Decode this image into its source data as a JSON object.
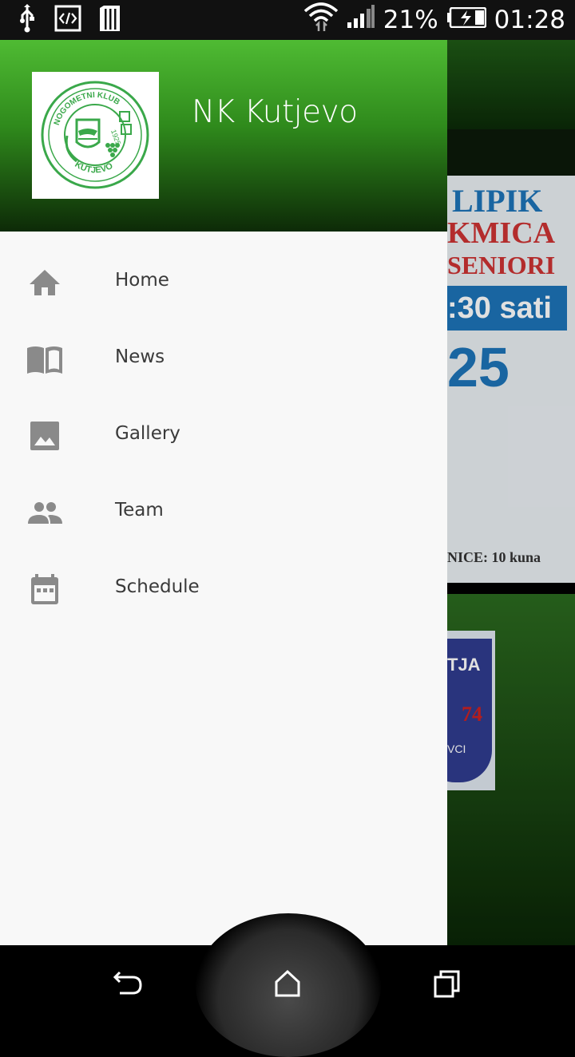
{
  "status_bar": {
    "battery_percent": "21%",
    "time": "01:28",
    "icons": [
      "usb-icon",
      "developer-mode-icon",
      "storage-icon",
      "wifi-icon",
      "signal-icon",
      "battery-charging-icon"
    ]
  },
  "background": {
    "poster_lines": [
      "LIPIK",
      "KMICA",
      "SENIORI",
      ":30 sati",
      "25",
      "NICE: 10 kuna"
    ],
    "badge_lines": [
      "TJA",
      "74",
      "VCI"
    ]
  },
  "drawer": {
    "title": "NK Kutjevo",
    "logo": {
      "top_text": "NOGOMETNI KLUB",
      "year": "1925",
      "bottom_text": "KUTJEVO"
    },
    "items": [
      {
        "label": "Home",
        "icon": "home-icon"
      },
      {
        "label": "News",
        "icon": "book-icon"
      },
      {
        "label": "Gallery",
        "icon": "image-icon"
      },
      {
        "label": "Team",
        "icon": "people-icon"
      },
      {
        "label": "Schedule",
        "icon": "calendar-icon"
      }
    ]
  },
  "nav_bar": {
    "buttons": [
      "back-icon",
      "home-nav-icon",
      "recents-icon"
    ]
  },
  "colors": {
    "header_green_top": "#4fbb33",
    "header_green_bottom": "#0d2a07",
    "drawer_bg": "#f8f8f8",
    "icon_gray": "#8a8a8a",
    "logo_green": "#3aa84a"
  }
}
